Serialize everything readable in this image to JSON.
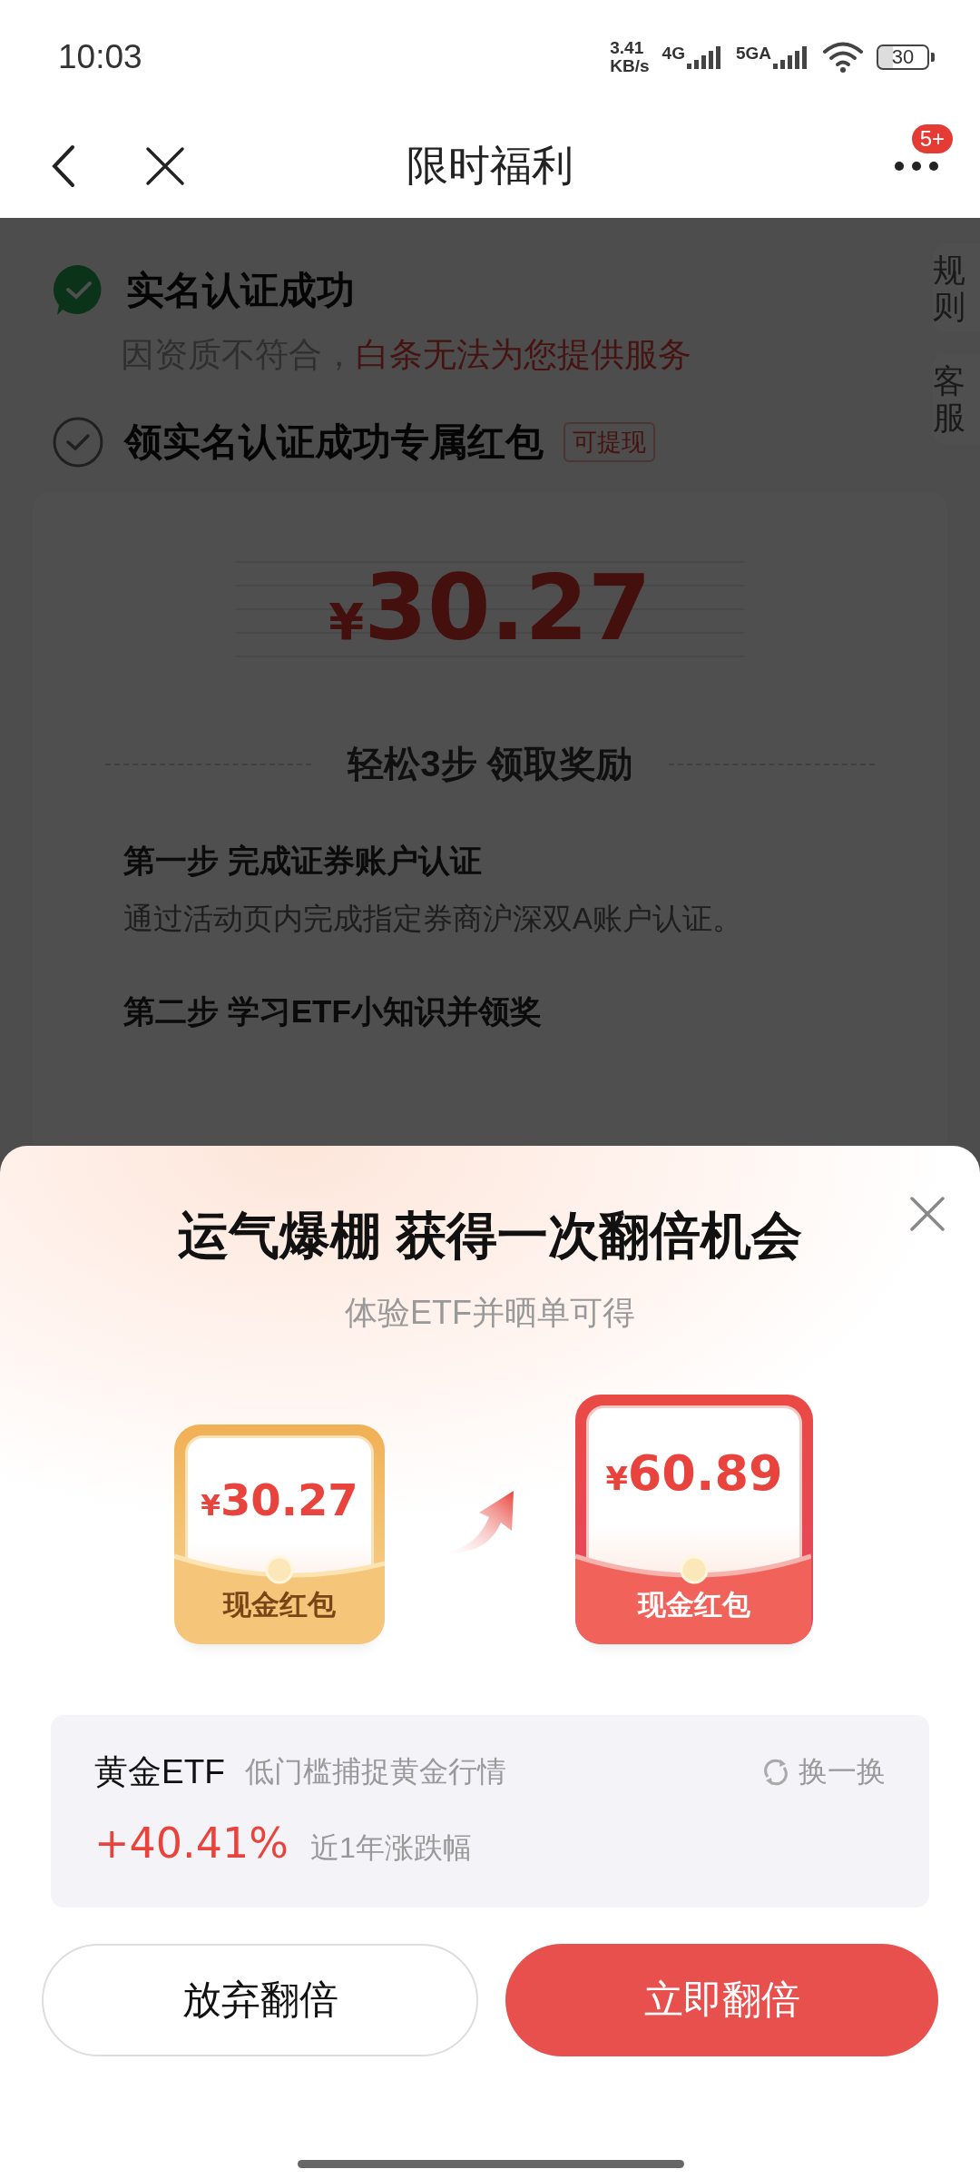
{
  "status_bar": {
    "time": "10:03",
    "speed_value": "3.41",
    "speed_unit": "KB/s",
    "networks": [
      "4G",
      "5GA"
    ],
    "battery": "30"
  },
  "nav": {
    "title": "限时福利",
    "badge": "5+"
  },
  "side_tabs": [
    "规则",
    "客服"
  ],
  "page": {
    "verify": {
      "title": "实名认证成功",
      "done": true,
      "note": "因资质不符合，",
      "note_highlight": "白条无法为您提供服务"
    },
    "task": {
      "title": "领实名认证成功专属红包",
      "done": false,
      "tag": "可提现"
    },
    "prize": {
      "currency": "¥",
      "amount": "30.27"
    },
    "steps_heading": "轻松3步 领取奖励",
    "steps": [
      {
        "title": "第一步 完成证券账户认证",
        "desc": "通过活动页内完成指定券商沪深双A账户认证。"
      },
      {
        "title": "第二步 学习ETF小知识并领奖"
      }
    ]
  },
  "sheet": {
    "title": "运气爆棚 获得一次翻倍机会",
    "subtitle": "体验ETF并晒单可得",
    "envelopes": [
      {
        "kind": "current",
        "currency": "¥",
        "amount": "30.27",
        "label": "现金红包"
      },
      {
        "kind": "doubled",
        "currency": "¥",
        "amount": "60.89",
        "label": "现金红包"
      }
    ],
    "fund": {
      "name": "黄金ETF",
      "slogan": "低门槛捕捉黄金行情",
      "change": "换一换",
      "return": "+40.41%",
      "return_label": "近1年涨跌幅"
    },
    "buttons": [
      {
        "kind": "secondary",
        "label": "放弃翻倍"
      },
      {
        "kind": "primary",
        "label": "立即翻倍"
      }
    ]
  }
}
